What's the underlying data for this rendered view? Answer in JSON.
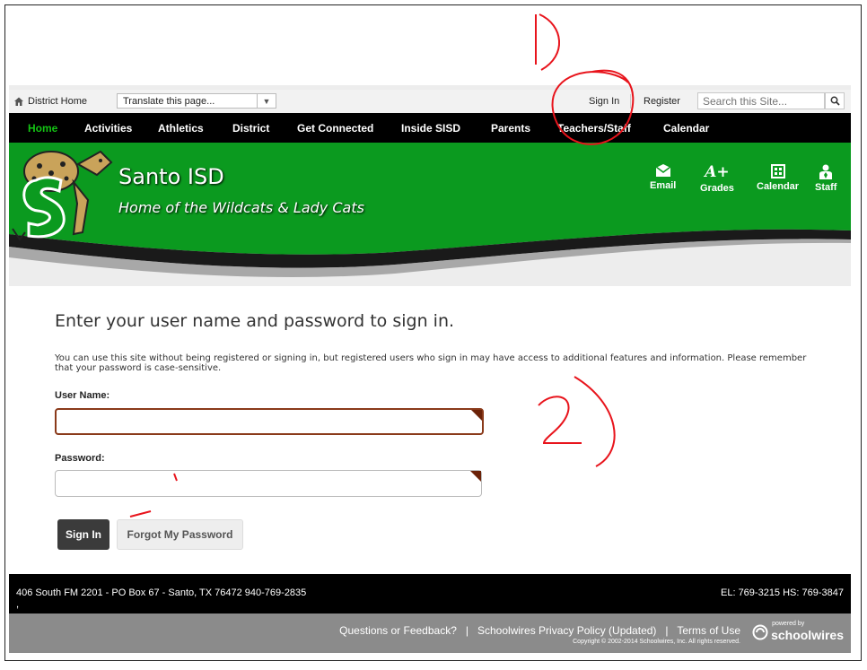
{
  "utility": {
    "district_home": "District Home",
    "translate_value": "Translate this page...",
    "sign_in": "Sign In",
    "register": "Register",
    "search_placeholder": "Search this Site..."
  },
  "nav": [
    "Home",
    "Activities",
    "Athletics",
    "District",
    "Get Connected",
    "Inside SISD",
    "Parents",
    "Teachers/Staff",
    "Calendar"
  ],
  "banner": {
    "school_name": "Santo ISD",
    "tagline": "Home of the Wildcats & Lady Cats",
    "quick_links": [
      {
        "label": "Email",
        "icon": "envelope-icon"
      },
      {
        "label": "Grades",
        "icon": "a-plus-icon",
        "glyph": "A+"
      },
      {
        "label": "Calendar",
        "icon": "calendar-icon"
      },
      {
        "label": "Staff",
        "icon": "person-icon"
      }
    ]
  },
  "login": {
    "heading": "Enter your user name and password to sign in.",
    "description": "You can use this site without being registered or signing in, but registered users who sign in may have access to additional features and information. Please remember that your password is case-sensitive.",
    "username_label": "User Name:",
    "username_value": "",
    "password_label": "Password:",
    "password_value": "",
    "signin_button": "Sign In",
    "forgot_button": "Forgot My Password"
  },
  "footer": {
    "address": "406 South FM 2201 - PO Box 67 - Santo, TX 76472 940-769-2835",
    "comma": ",",
    "phones": "EL: 769-3215 HS: 769-3847"
  },
  "bottom": {
    "links": "Questions or Feedback?   |   Schoolwires Privacy Policy (Updated)   |   Terms of Use",
    "copyright": "Copyright © 2002-2014 Schoolwires, Inc. All rights reserved.",
    "powered_by": "powered by",
    "brand": "schoolwires"
  },
  "annotations": {
    "one": "1)",
    "two": "2)"
  },
  "colors": {
    "green": "#0b9a1f",
    "nav_bg": "#000000",
    "home_green": "#14c414",
    "annotation_red": "#e8141c"
  }
}
